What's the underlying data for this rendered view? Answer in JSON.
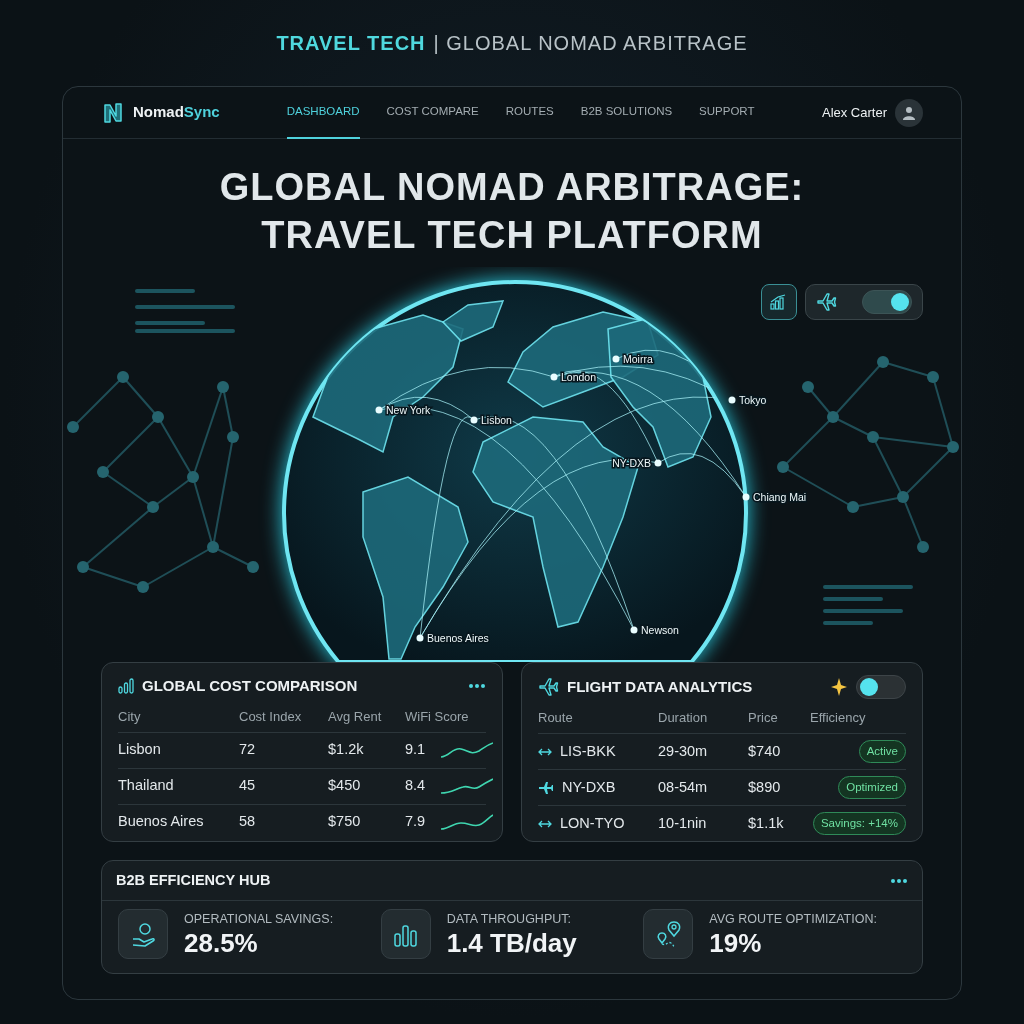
{
  "header": {
    "title": "TRAVEL TECH",
    "subtitle": "| GLOBAL NOMAD ARBITRAGE"
  },
  "navbar": {
    "brand": "Nomad",
    "brand_accent": "Sync",
    "links": [
      {
        "label": "DASHBOARD",
        "selected": true
      },
      {
        "label": "COST COMPARE",
        "selected": false
      },
      {
        "label": "ROUTES",
        "selected": false
      },
      {
        "label": "B2B SOLUTIONS",
        "selected": false
      },
      {
        "label": "SUPPORT",
        "selected": false
      }
    ],
    "user": "Alex Carter"
  },
  "hero": {
    "title_lines": [
      "GLOBAL NOMAD ARBITRAGE:",
      "TRAVEL TECH PLATFORM"
    ]
  },
  "map": {
    "cities": [
      {
        "name": "Moirra"
      },
      {
        "name": "London"
      },
      {
        "name": "Tokyo"
      },
      {
        "name": "New York"
      },
      {
        "name": "Lisbon"
      },
      {
        "name": "NY-DXB"
      },
      {
        "name": "Chiang Mai"
      },
      {
        "name": "Newson"
      },
      {
        "name": "Buenos Aires"
      }
    ],
    "flight_toggle": {
      "on": true
    }
  },
  "cost_card": {
    "title": "GLOBAL COST COMPARISON",
    "columns": [
      "City",
      "Cost Index",
      "Avg Rent",
      "WiFi Score"
    ],
    "rows": [
      {
        "city": "Lisbon",
        "cost_index": "72",
        "avg_rent": "$1.2k",
        "wifi_score": "9.1"
      },
      {
        "city": "Thailand",
        "cost_index": "45",
        "avg_rent": "$450",
        "wifi_score": "8.4"
      },
      {
        "city": "Buenos Aires",
        "cost_index": "58",
        "avg_rent": "$750",
        "wifi_score": "7.9"
      }
    ]
  },
  "flight_card": {
    "title": "FLIGHT DATA ANALYTICS",
    "toggle": {
      "on": false
    },
    "columns": [
      "Route",
      "Duration",
      "Price",
      "Efficiency"
    ],
    "rows": [
      {
        "kind": "arrow",
        "route": "LIS-BKK",
        "duration": "29-30m",
        "price": "$740",
        "efficiency": "Active"
      },
      {
        "kind": "plane",
        "route": "NY-DXB",
        "duration": "08-54m",
        "price": "$890",
        "efficiency": "Optimized"
      },
      {
        "kind": "arrow",
        "route": "LON-TYO",
        "duration": "10-1nin",
        "price": "$1.1k",
        "efficiency": "Savings: +14%"
      }
    ]
  },
  "hub": {
    "title": "B2B EFFICIENCY HUB",
    "stats": [
      {
        "kind": "savings",
        "label": "OPERATIONAL SAVINGS:",
        "value": "28.5%"
      },
      {
        "kind": "throughput",
        "label": "DATA THROUGHPUT:",
        "value": "1.4 TB/day"
      },
      {
        "kind": "route",
        "label": "AVG ROUTE OPTIMIZATION:",
        "value": "19%"
      }
    ]
  }
}
